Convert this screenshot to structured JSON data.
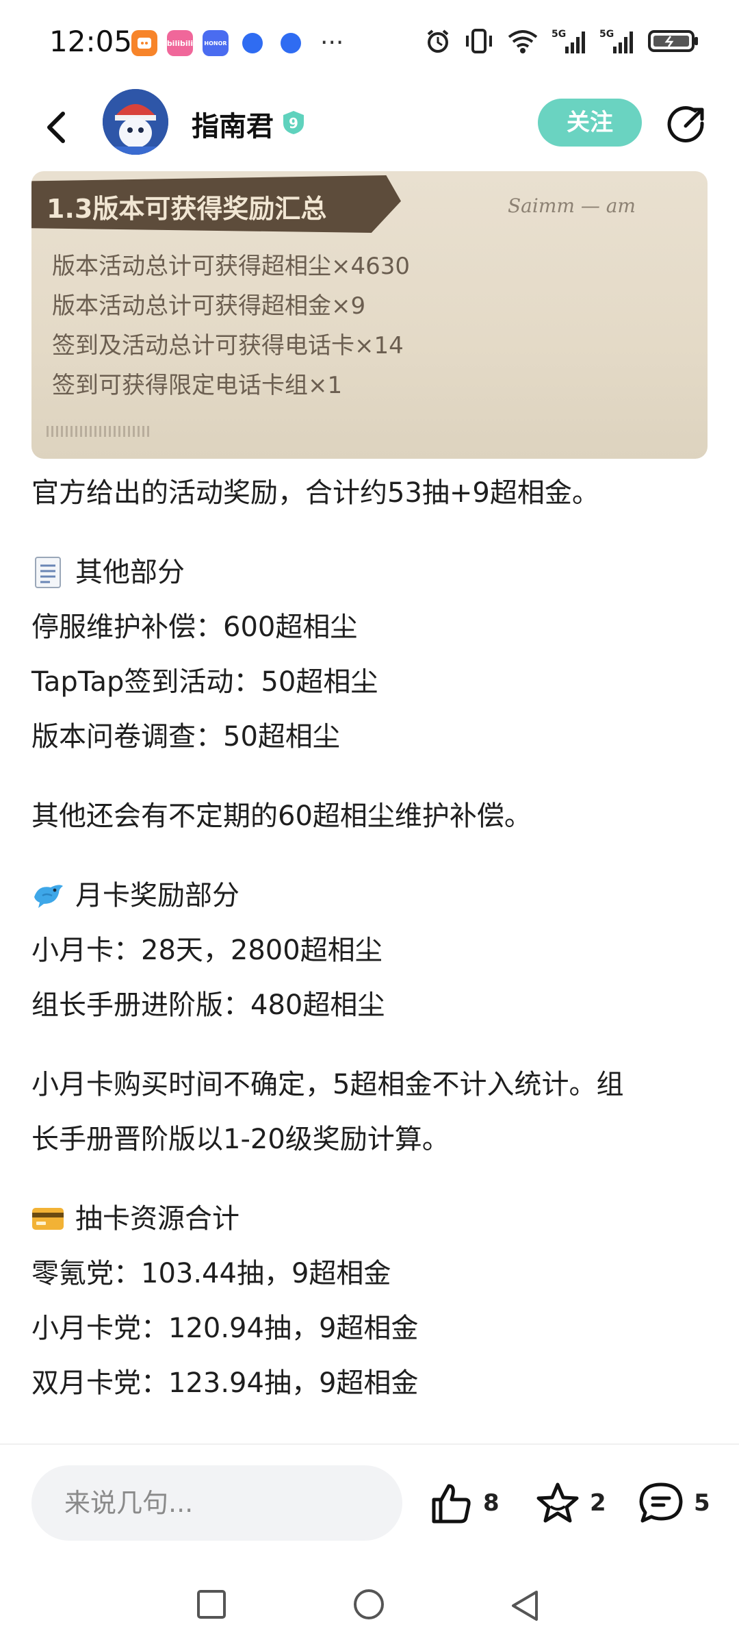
{
  "status_bar": {
    "time": "12:05",
    "app_icons": [
      {
        "name": "taobao-icon",
        "color": "#f7842a"
      },
      {
        "name": "bilibili-icon",
        "color": "#f0679a",
        "text": "bilibili"
      },
      {
        "name": "honor-icon",
        "color": "#4a6cf0",
        "text": "HONOR"
      },
      {
        "name": "blue-dot-icon",
        "color": "#2f6cf2"
      },
      {
        "name": "blue-dot-icon",
        "color": "#2f6cf2"
      }
    ],
    "more": "···",
    "network": "5G"
  },
  "header": {
    "author": "指南君",
    "level": "9",
    "follow_label": "关注"
  },
  "banner": {
    "title": "1.3版本可获得奖励汇总",
    "signature": "Saimm — am",
    "lines": [
      "版本活动总计可获得超相尘×4630",
      "版本活动总计可获得超相金×9",
      "签到及活动总计可获得电话卡×14",
      "签到可获得限定电话卡组×1"
    ]
  },
  "article": {
    "intro": "官方给出的活动奖励，合计约53抽+9超相金。",
    "other": {
      "heading": "其他部分",
      "icon": "document-icon",
      "items": [
        "停服维护补偿：600超相尘",
        "TapTap签到活动：50超相尘",
        "版本问卷调查：50超相尘"
      ],
      "note": "其他还会有不定期的60超相尘维护补偿。"
    },
    "monthly": {
      "heading": "月卡奖励部分",
      "icon": "bird-icon",
      "items": [
        "小月卡：28天，2800超相尘",
        "组长手册进阶版：480超相尘"
      ],
      "note_line1": "小月卡购买时间不确定，5超相金不计入统计。组",
      "note_line2": "长手册晋阶版以1-20级奖励计算。"
    },
    "total": {
      "heading": "抽卡资源合计",
      "icon": "credit-card-icon",
      "items": [
        "零氪党：103.44抽，9超相金",
        "小月卡党：120.94抽，9超相金",
        "双月卡党：123.94抽，9超相金"
      ]
    }
  },
  "bottom_bar": {
    "comment_placeholder": "来说几句...",
    "likes": "8",
    "favorites": "2",
    "comments": "5"
  },
  "colors": {
    "accent": "#6ad3c1",
    "banner_tag": "#5d4c3b"
  }
}
